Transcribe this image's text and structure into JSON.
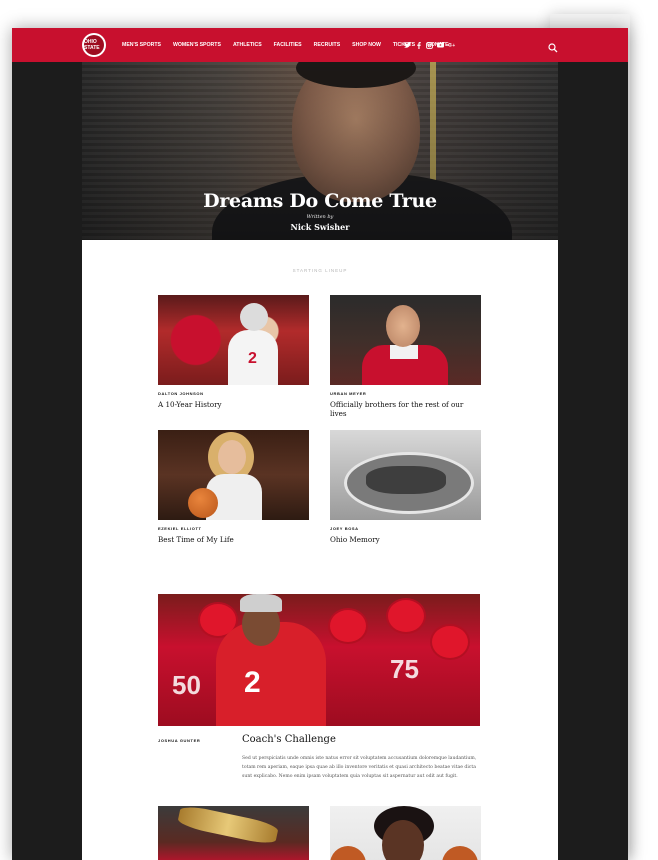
{
  "nav": {
    "logo_text": "OHIO STATE",
    "menu": [
      "MEN'S SPORTS",
      "WOMEN'S SPORTS",
      "ATHLETICS",
      "FACILITIES",
      "RECRUITS",
      "SHOP NOW",
      "TICKETS",
      "DONATE"
    ],
    "social": [
      "twitter-icon",
      "facebook-icon",
      "instagram-icon",
      "youtube-icon",
      "google-plus-icon"
    ]
  },
  "hero": {
    "title": "Dreams Do Come True",
    "written_by": "Written by",
    "author": "Nick Swisher",
    "slides": 3,
    "active_slide": 1
  },
  "section": {
    "label": "STARTING LINEUP"
  },
  "cards": [
    {
      "author": "DALTON JOHNSON",
      "title": "A 10-Year History"
    },
    {
      "author": "URBAN MEYER",
      "title": "Officially brothers for the rest of our lives"
    },
    {
      "author": "EZEKIEL ELLIOTT",
      "title": "Best Time of My Life"
    },
    {
      "author": "JOEY BOSA",
      "title": "Ohio Memory"
    }
  ],
  "feature": {
    "author": "JOSHUA GUNTER",
    "title": "Coach's Challenge",
    "body": "Sed ut perspiciatis unde omnis iste natus error sit voluptatem accusantium doloremque laudantium, totam rem aperiam, eaque ipsa quae ab illo inventore veritatis et quasi architecto beatae vitae dicta sunt explicabo. Nemo enim ipsam voluptatem quia voluptas sit aspernatur aut odit aut fugit."
  },
  "colors": {
    "brand_red": "#c8102e",
    "frame_dark": "#1c1c1c"
  }
}
